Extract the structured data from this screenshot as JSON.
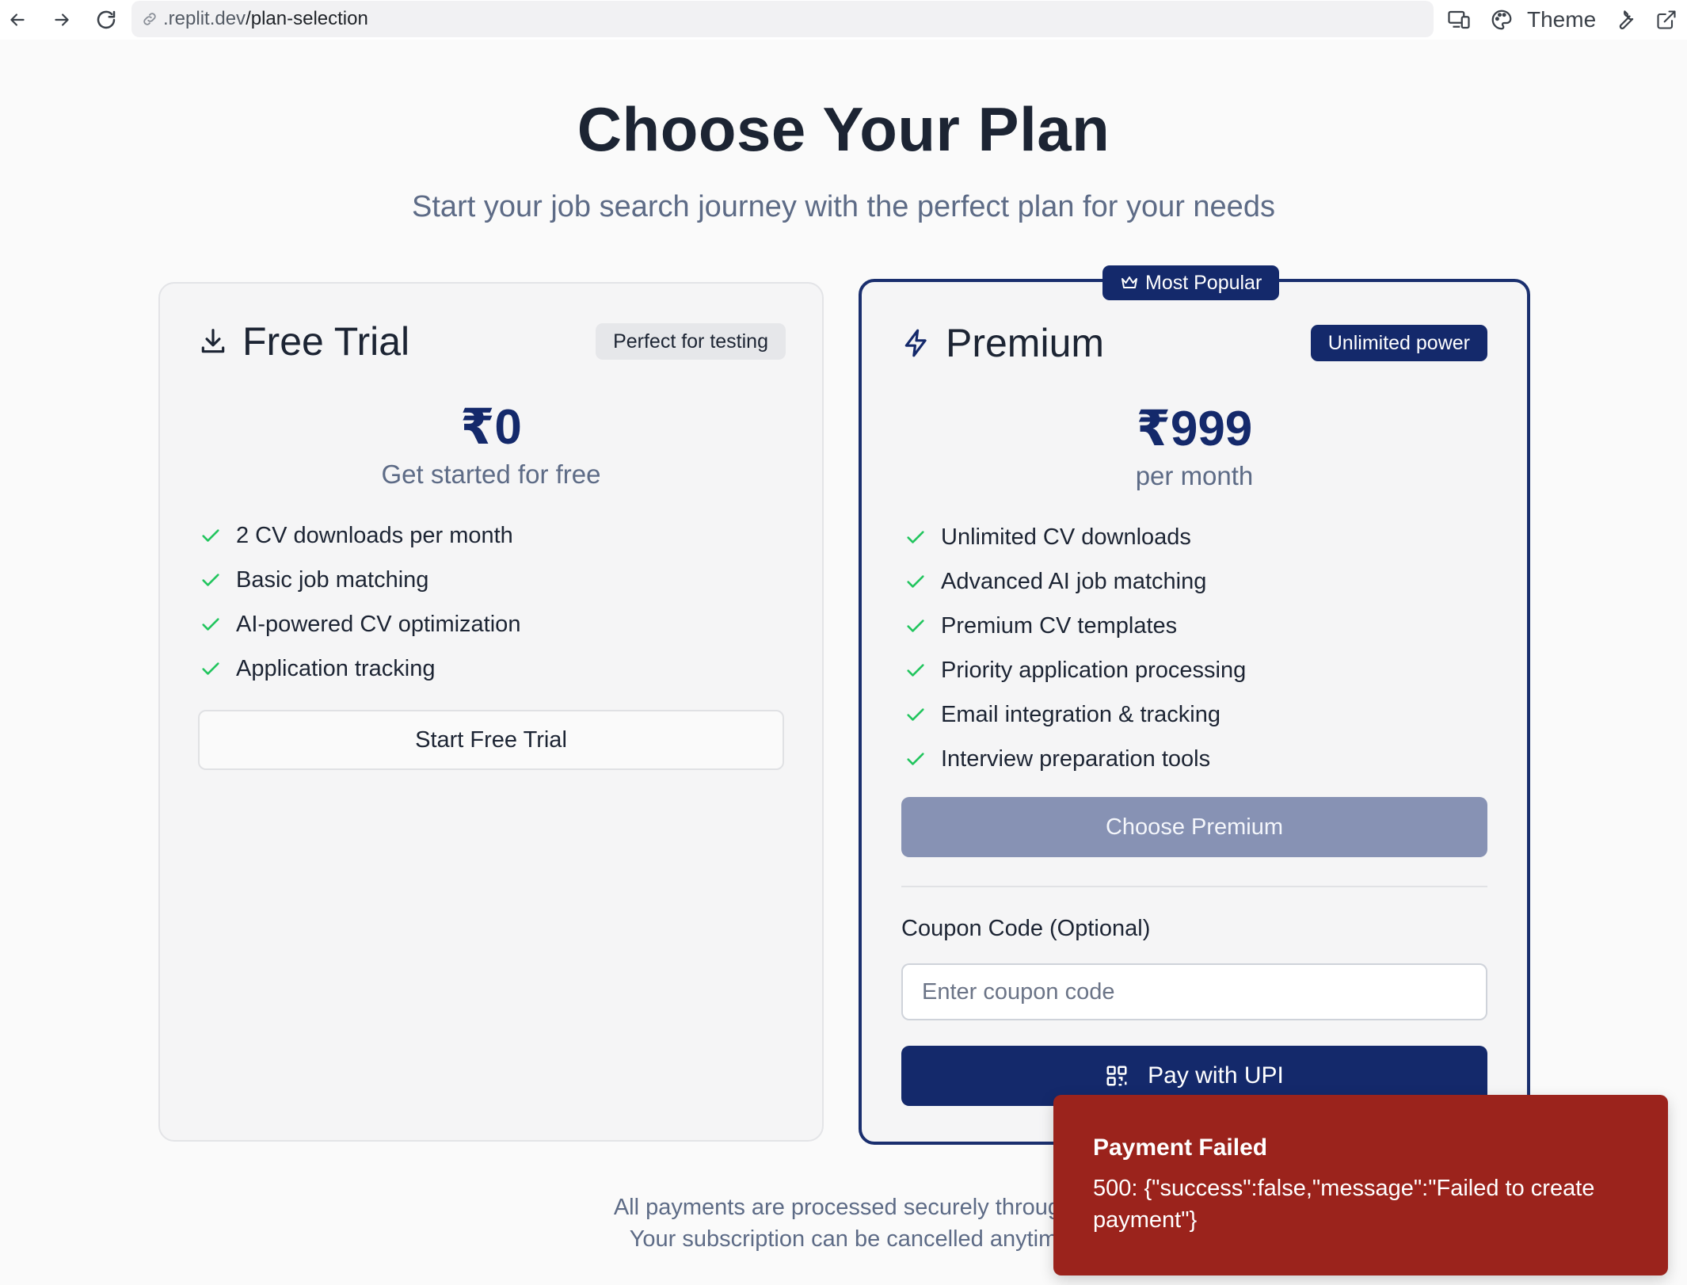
{
  "browser": {
    "url_host": ".replit.dev",
    "url_path": "/plan-selection",
    "theme_label": "Theme"
  },
  "header": {
    "title": "Choose Your Plan",
    "subtitle": "Start your job search journey with the perfect plan for your needs"
  },
  "plans": {
    "free": {
      "title": "Free Trial",
      "tag": "Perfect for testing",
      "price": "₹0",
      "price_caption": "Get started for free",
      "features": [
        "2 CV downloads per month",
        "Basic job matching",
        "AI-powered CV optimization",
        "Application tracking"
      ],
      "button_label": "Start Free Trial"
    },
    "premium": {
      "badge": "Most Popular",
      "title": "Premium",
      "tag": "Unlimited power",
      "price": "₹999",
      "price_caption": "per month",
      "features": [
        "Unlimited CV downloads",
        "Advanced AI job matching",
        "Premium CV templates",
        "Priority application processing",
        "Email integration & tracking",
        "Interview preparation tools"
      ],
      "button_label": "Choose Premium",
      "coupon_label": "Coupon Code (Optional)",
      "coupon_placeholder": "Enter coupon code",
      "coupon_value": "",
      "pay_button_label": "Pay with UPI"
    }
  },
  "footer": {
    "line1": "All payments are processed securely through",
    "line2": "Your subscription can be cancelled anytim"
  },
  "toast": {
    "title": "Payment Failed",
    "message": "500: {\"success\":false,\"message\":\"Failed to create payment\"}"
  },
  "colors": {
    "brand": "#14296b",
    "check": "#22c55e",
    "error": "#9b231c"
  }
}
